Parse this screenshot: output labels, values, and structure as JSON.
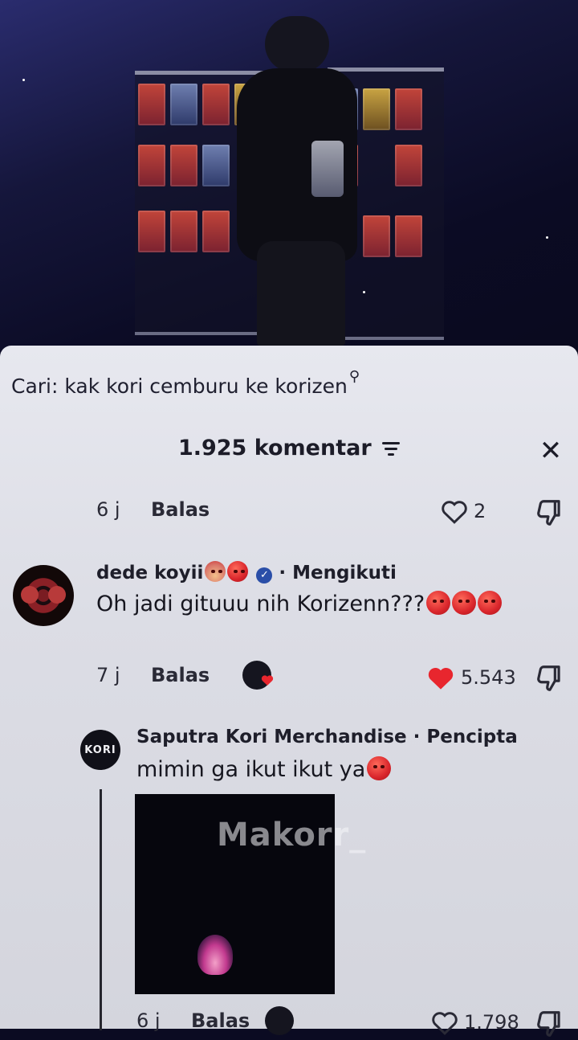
{
  "search": {
    "prefix": "Cari:",
    "query": "kak kori cemburu ke korizen"
  },
  "header": {
    "count_label": "1.925 komentar"
  },
  "comments": [
    {
      "time": "6 j",
      "reply_label": "Balas",
      "likes": "2",
      "liked": false
    },
    {
      "username": "dede koyii",
      "tag": "· Mengikuti",
      "text": "Oh jadi gituuu nih Korizenn???",
      "time": "7 j",
      "reply_label": "Balas",
      "likes": "5.543",
      "liked": true
    },
    {
      "username": "Saputra Kori Merchandise",
      "tag": "· Pencipta",
      "text": "mimin ga ikut ikut ya",
      "avatar_text": "KORI",
      "time": "6 j",
      "reply_label": "Balas",
      "likes": "1.798",
      "liked": false
    }
  ],
  "watermark": "Makorr_",
  "colors": {
    "like_red": "#e8262e",
    "sheet_bg": "#dcdde5",
    "text_dark": "#1c1c28"
  }
}
